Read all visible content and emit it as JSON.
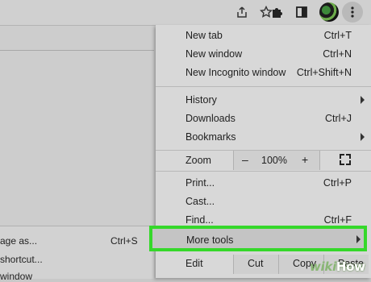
{
  "toolbar": {
    "icons": [
      "share-icon",
      "star-icon",
      "extensions-icon",
      "side-panel-icon",
      "profile-avatar",
      "kebab-menu-icon"
    ]
  },
  "menu": {
    "new_tab": {
      "label": "New tab",
      "shortcut": "Ctrl+T"
    },
    "new_window": {
      "label": "New window",
      "shortcut": "Ctrl+N"
    },
    "new_incognito": {
      "label": "New Incognito window",
      "shortcut": "Ctrl+Shift+N"
    },
    "history": {
      "label": "History"
    },
    "downloads": {
      "label": "Downloads",
      "shortcut": "Ctrl+J"
    },
    "bookmarks": {
      "label": "Bookmarks"
    },
    "zoom": {
      "label": "Zoom",
      "minus": "–",
      "value": "100%",
      "plus": "+"
    },
    "print": {
      "label": "Print...",
      "shortcut": "Ctrl+P"
    },
    "cast": {
      "label": "Cast..."
    },
    "find": {
      "label": "Find...",
      "shortcut": "Ctrl+F"
    },
    "more_tools": {
      "label": "More tools"
    },
    "edit": {
      "label": "Edit",
      "cut": "Cut",
      "copy": "Copy",
      "paste": "Paste"
    }
  },
  "submenu": {
    "save_page": {
      "label": "age as...",
      "shortcut": "Ctrl+S"
    },
    "create_shortcut": {
      "label": "shortcut..."
    },
    "name_window": {
      "label": "window"
    }
  },
  "watermark": {
    "part1": "wiki",
    "part2": "How"
  },
  "colors": {
    "highlight": "#35d82a",
    "menu_bg": "#d8d8d8"
  }
}
